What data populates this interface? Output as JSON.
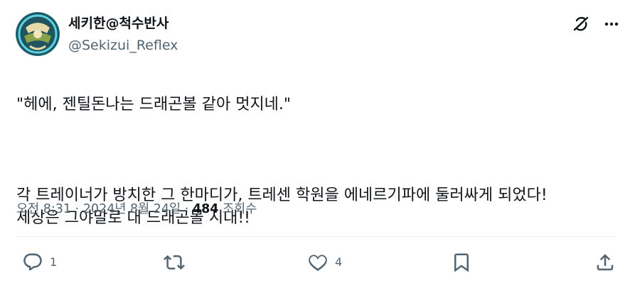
{
  "author": {
    "display_name": "세키한@척수반사",
    "handle": "@Sekizui_Reflex"
  },
  "tweet": {
    "line1": "\"헤에, 젠틸돈나는 드래곤볼 같아 멋지네.\"",
    "line2": "각 트레이너가 방치한 그 한마디가, 트레센 학원을 에네르기파에 둘러싸게 되었다!\n세상은 그야말로 대 드래곤볼 시대!!"
  },
  "meta": {
    "time": "오전 8:31",
    "separator": "·",
    "date": "2024년 8월 24일",
    "views_count": "484",
    "views_label": "조회수"
  },
  "actions": {
    "reply_count": "1",
    "retweet_count": "",
    "like_count": "4"
  },
  "icons": [
    "grok-icon",
    "more-icon",
    "reply-icon",
    "retweet-icon",
    "like-icon",
    "bookmark-icon",
    "share-icon"
  ],
  "colors": {
    "text": "#0f1419",
    "secondary": "#536471",
    "divider": "#eff3f4"
  }
}
